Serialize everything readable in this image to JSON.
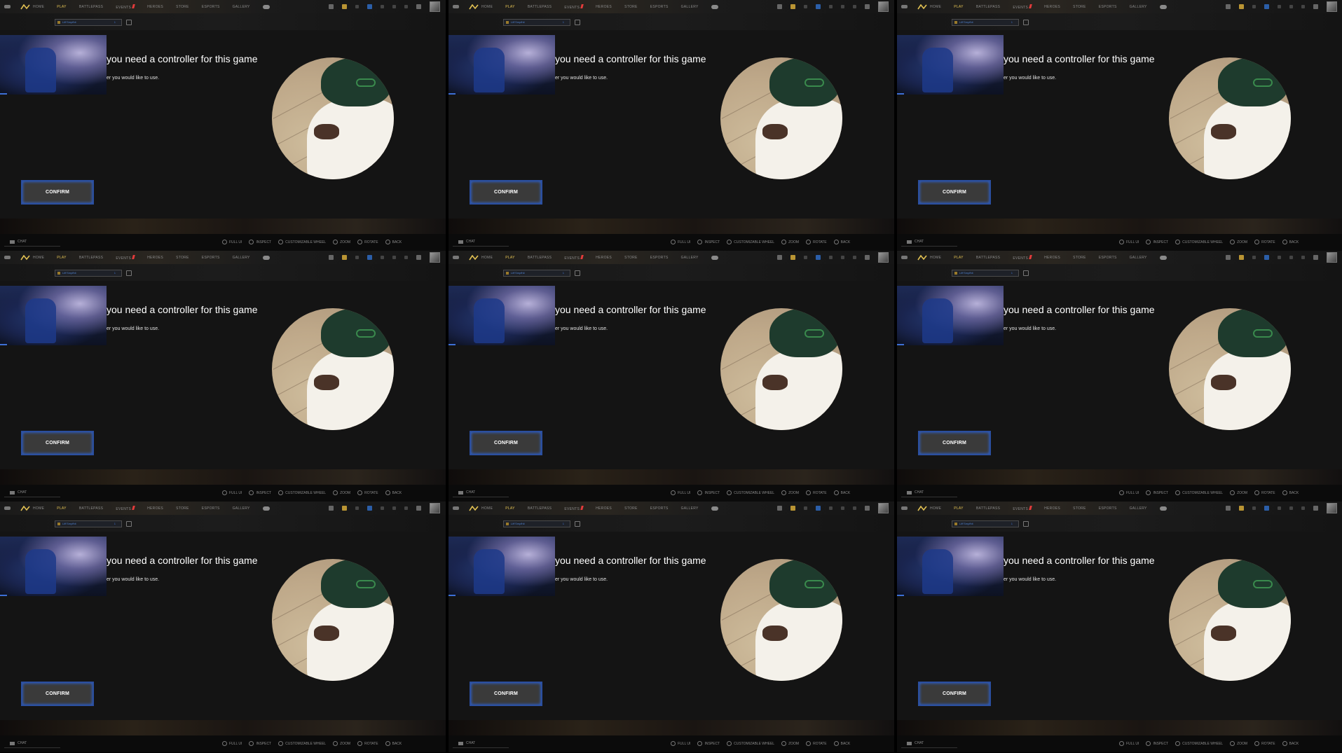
{
  "nav": {
    "items": [
      "HOME",
      "PLAY",
      "BATTLEPASS",
      "EVENTS",
      "HEROES",
      "STORE",
      "ESPORTS",
      "GALLERY"
    ],
    "active": "PLAY"
  },
  "currency": {
    "vc_label": "Lift'Smpfhit",
    "vc_amount": "1"
  },
  "modal": {
    "title": "you need a controller for this game",
    "subtitle": "er you would like to use.",
    "confirm_label": "CONFIRM"
  },
  "bottom": {
    "chat_label": "CHAT",
    "hints": [
      "FULL UI",
      "INSPECT",
      "CUSTOMIZABLE WHEEL",
      "ZOOM",
      "ROTATE",
      "BACK"
    ]
  },
  "colors": {
    "active_nav": "#e2c153",
    "confirm_border": "#2b4fa0",
    "modal_bg": "#141414"
  }
}
